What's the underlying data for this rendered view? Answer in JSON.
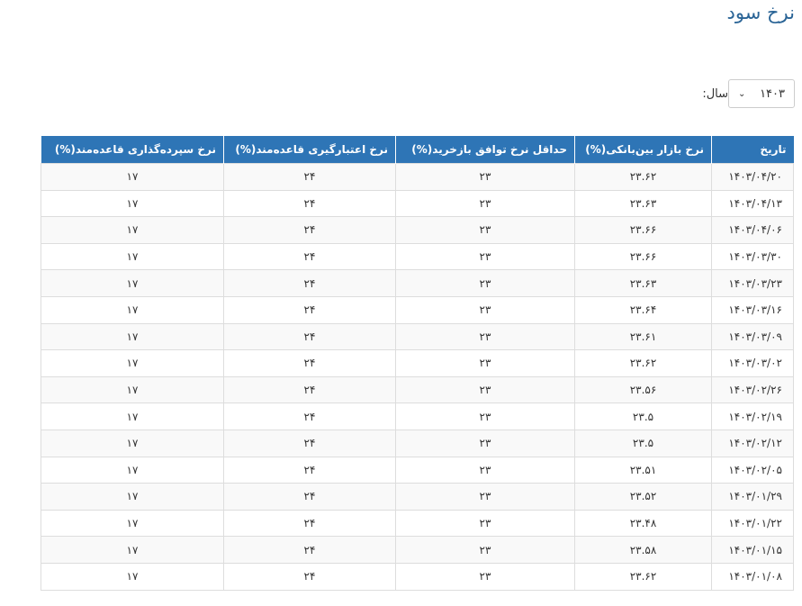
{
  "page": {
    "title": "نرخ سود"
  },
  "filter": {
    "year_label": "سال:",
    "year_value": "۱۴۰۳",
    "chevron": "⌄"
  },
  "table": {
    "headers": [
      "تاریخ",
      "نرخ بازار بین‌بانکی(%)",
      "حداقل نرخ توافق بازخرید(%)",
      "نرخ اعتبارگیری قاعده‌مند(%)",
      "نرخ سپرده‌گذاری قاعده‌مند(%)"
    ],
    "rows": [
      [
        "۱۴۰۳/۰۴/۲۰",
        "۲۳.۶۲",
        "۲۳",
        "۲۴",
        "۱۷"
      ],
      [
        "۱۴۰۳/۰۴/۱۳",
        "۲۳.۶۳",
        "۲۳",
        "۲۴",
        "۱۷"
      ],
      [
        "۱۴۰۳/۰۴/۰۶",
        "۲۳.۶۶",
        "۲۳",
        "۲۴",
        "۱۷"
      ],
      [
        "۱۴۰۳/۰۳/۳۰",
        "۲۳.۶۶",
        "۲۳",
        "۲۴",
        "۱۷"
      ],
      [
        "۱۴۰۳/۰۳/۲۳",
        "۲۳.۶۳",
        "۲۳",
        "۲۴",
        "۱۷"
      ],
      [
        "۱۴۰۳/۰۳/۱۶",
        "۲۳.۶۴",
        "۲۳",
        "۲۴",
        "۱۷"
      ],
      [
        "۱۴۰۳/۰۳/۰۹",
        "۲۳.۶۱",
        "۲۳",
        "۲۴",
        "۱۷"
      ],
      [
        "۱۴۰۳/۰۳/۰۲",
        "۲۳.۶۲",
        "۲۳",
        "۲۴",
        "۱۷"
      ],
      [
        "۱۴۰۳/۰۲/۲۶",
        "۲۳.۵۶",
        "۲۳",
        "۲۴",
        "۱۷"
      ],
      [
        "۱۴۰۳/۰۲/۱۹",
        "۲۳.۵",
        "۲۳",
        "۲۴",
        "۱۷"
      ],
      [
        "۱۴۰۳/۰۲/۱۲",
        "۲۳.۵",
        "۲۳",
        "۲۴",
        "۱۷"
      ],
      [
        "۱۴۰۳/۰۲/۰۵",
        "۲۳.۵۱",
        "۲۳",
        "۲۴",
        "۱۷"
      ],
      [
        "۱۴۰۳/۰۱/۲۹",
        "۲۳.۵۲",
        "۲۳",
        "۲۴",
        "۱۷"
      ],
      [
        "۱۴۰۳/۰۱/۲۲",
        "۲۳.۴۸",
        "۲۳",
        "۲۴",
        "۱۷"
      ],
      [
        "۱۴۰۳/۰۱/۱۵",
        "۲۳.۵۸",
        "۲۳",
        "۲۴",
        "۱۷"
      ],
      [
        "۱۴۰۳/۰۱/۰۸",
        "۲۳.۶۲",
        "۲۳",
        "۲۴",
        "۱۷"
      ]
    ]
  },
  "colors": {
    "header_bg": "#2e75b6",
    "title": "#2a6496"
  }
}
